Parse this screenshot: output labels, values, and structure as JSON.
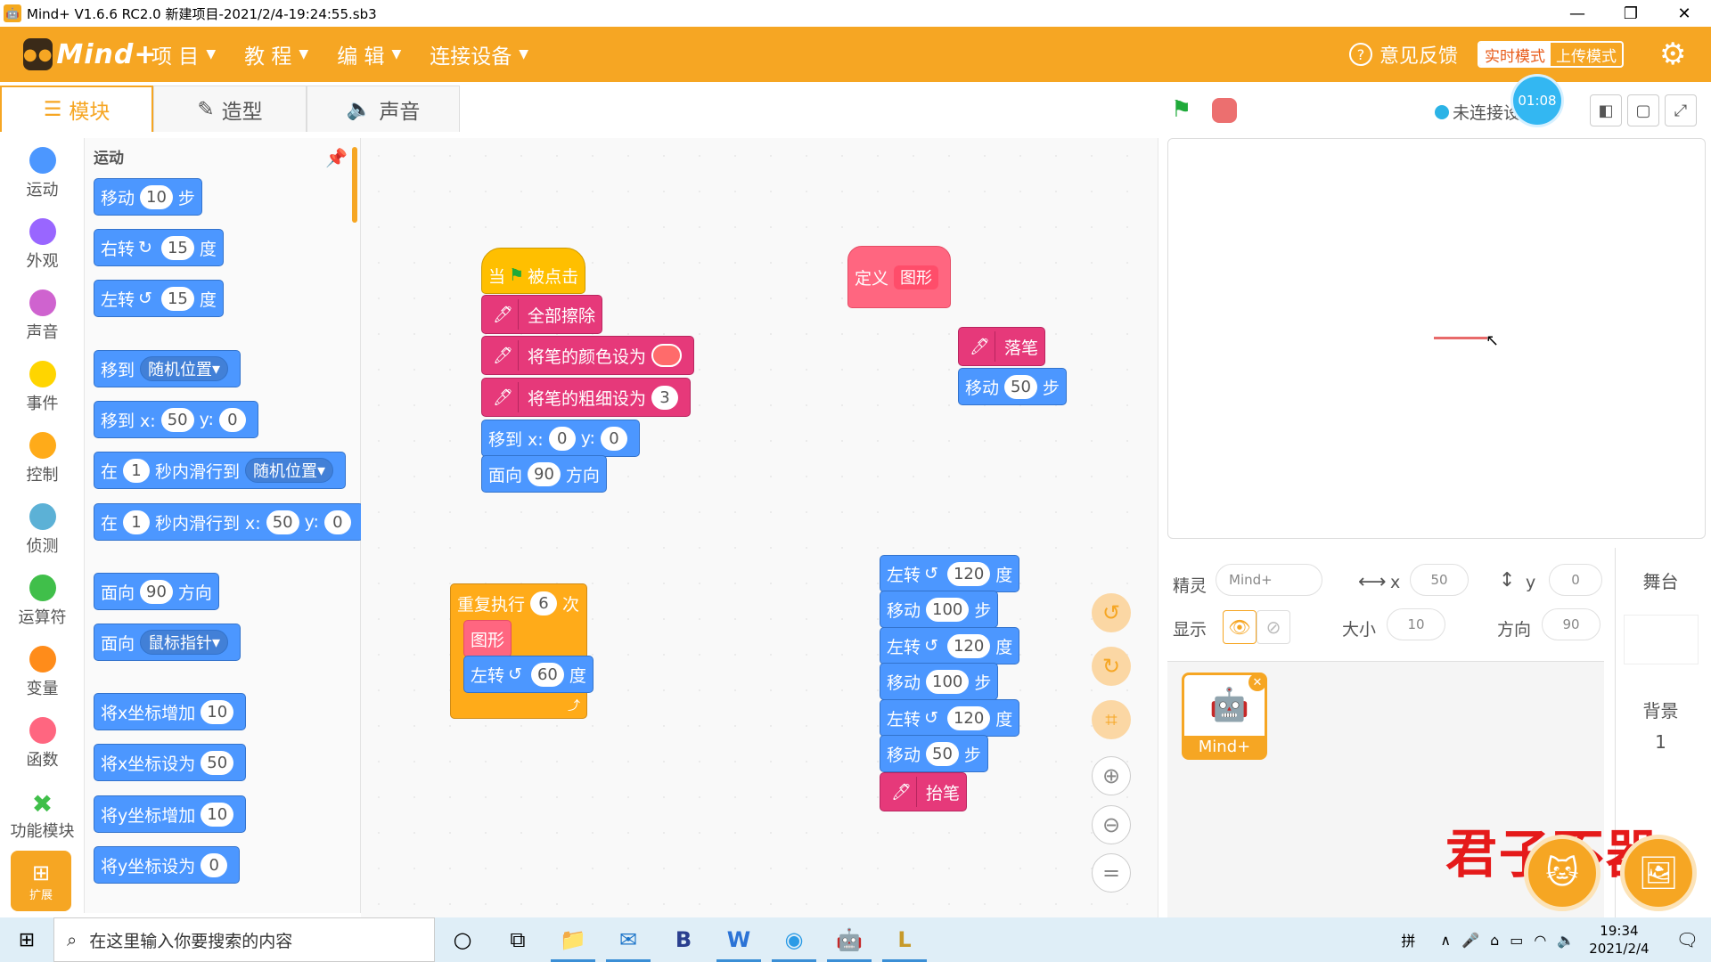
{
  "window": {
    "title": "Mind+ V1.6.6 RC2.0   新建项目-2021/2/4-19:24:55.sb3"
  },
  "menubar": {
    "logo": "Mind+",
    "menus": [
      "项 目",
      "教 程",
      "编 辑",
      "连接设备"
    ],
    "feedback": "意见反馈",
    "mode_live": "实时模式",
    "mode_upload": "上传模式"
  },
  "tabs": [
    "模块",
    "造型",
    "声音"
  ],
  "categories": [
    {
      "label": "运动",
      "color": "#4c97ff"
    },
    {
      "label": "外观",
      "color": "#9966ff"
    },
    {
      "label": "声音",
      "color": "#cf63cf"
    },
    {
      "label": "事件",
      "color": "#ffd500"
    },
    {
      "label": "控制",
      "color": "#ffab19"
    },
    {
      "label": "侦测",
      "color": "#5cb1d6"
    },
    {
      "label": "运算符",
      "color": "#40bf4a"
    },
    {
      "label": "变量",
      "color": "#ff8c1a"
    },
    {
      "label": "函数",
      "color": "#ff6680"
    }
  ],
  "func_module": "功能模块",
  "ext_label": "扩展",
  "palette": {
    "title": "运动",
    "move": [
      "移动",
      "10",
      "步"
    ],
    "turn_right": [
      "右转",
      "15",
      "度"
    ],
    "turn_left": [
      "左转",
      "15",
      "度"
    ],
    "goto": [
      "移到",
      "随机位置"
    ],
    "goto_xy": [
      "移到 x:",
      "50",
      "y:",
      "0"
    ],
    "glide": [
      "在",
      "1",
      "秒内滑行到",
      "随机位置"
    ],
    "glide_xy": [
      "在",
      "1",
      "秒内滑行到 x:",
      "50",
      "y:",
      "0"
    ],
    "point_dir": [
      "面向",
      "90",
      "方向"
    ],
    "point_towards": [
      "面向",
      "鼠标指针"
    ],
    "change_x": [
      "将x坐标增加",
      "10"
    ],
    "set_x": [
      "将x坐标设为",
      "50"
    ],
    "change_y": [
      "将y坐标增加",
      "10"
    ],
    "set_y": [
      "将y坐标设为",
      "0"
    ]
  },
  "script1": {
    "hat": [
      "当",
      "被点击"
    ],
    "clear": "全部擦除",
    "set_color": "将笔的颜色设为",
    "set_size": [
      "将笔的粗细设为",
      "3"
    ],
    "goto": [
      "移到 x:",
      "0",
      "y:",
      "0"
    ],
    "point": [
      "面向",
      "90",
      "方向"
    ]
  },
  "script2": {
    "define": [
      "定义",
      "图形"
    ],
    "pendown": "落笔",
    "move": [
      "移动",
      "50",
      "步"
    ]
  },
  "script3": {
    "repeat": [
      "重复执行",
      "6",
      "次"
    ],
    "call": "图形",
    "turn": [
      "左转",
      "60",
      "度"
    ]
  },
  "script4": {
    "rows": [
      [
        "左转",
        "120",
        "度"
      ],
      [
        "移动",
        "100",
        "步"
      ],
      [
        "左转",
        "120",
        "度"
      ],
      [
        "移动",
        "100",
        "步"
      ],
      [
        "左转",
        "120",
        "度"
      ],
      [
        "移动",
        "50",
        "步"
      ]
    ],
    "penup": "抬笔"
  },
  "stagebar": {
    "connection": "未连接设",
    "timer": "01:08"
  },
  "props": {
    "sprite_label": "精灵",
    "sprite_name": "Mind+",
    "x_label": "x",
    "x": "50",
    "y_label": "y",
    "y": "0",
    "show_label": "显示",
    "size_label": "大小",
    "size": "10",
    "dir_label": "方向",
    "dir": "90"
  },
  "sprite_card": {
    "name": "Mind+"
  },
  "stage_col": {
    "title": "舞台",
    "bg_label": "背景",
    "bg_count": "1"
  },
  "watermark": "君子不器",
  "taskbar": {
    "search_placeholder": "在这里输入你要搜索的内容",
    "ime": "拼",
    "time": "19:34",
    "date": "2021/2/4"
  }
}
